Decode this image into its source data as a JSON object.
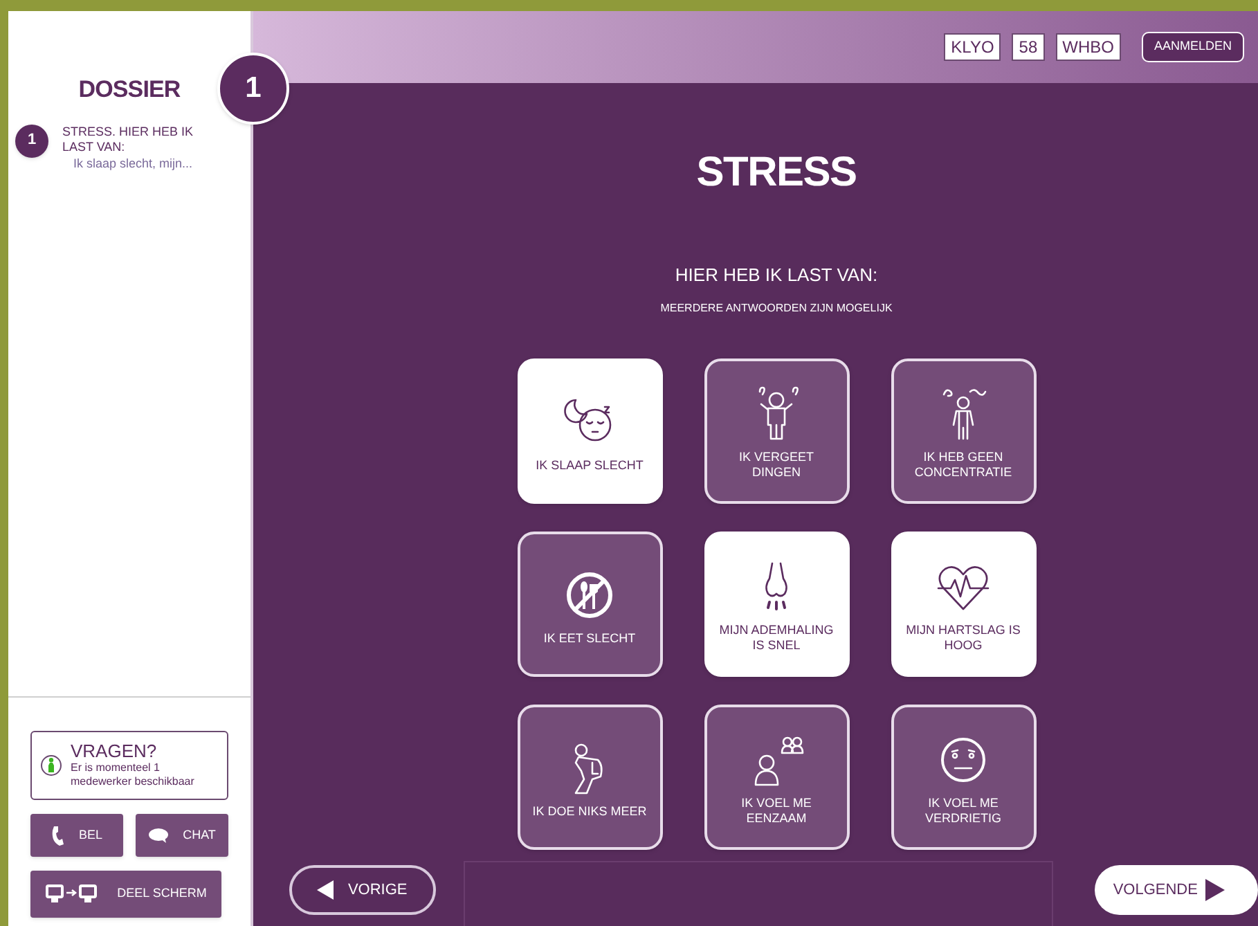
{
  "sidebar": {
    "title": "DOSSIER",
    "items": [
      {
        "number": "1",
        "title": "STRESS. HIER HEB IK LAST VAN:",
        "summary": "Ik slaap slecht, mijn..."
      }
    ],
    "help": {
      "title": "VRAGEN?",
      "status": "Er is momenteel 1 medewerker beschikbaar",
      "online": true
    },
    "buttons": [
      {
        "kind": "call",
        "label": "BEL"
      },
      {
        "kind": "chat",
        "label": "CHAT"
      },
      {
        "kind": "share",
        "label": "DEEL SCHERM"
      }
    ]
  },
  "header": {
    "step": "1",
    "codes": [
      "KLYO",
      "58",
      "WHBO"
    ],
    "login": "AANMELDEN"
  },
  "question": {
    "title": "STRESS",
    "prompt": "HIER HEB IK LAST VAN:",
    "hint": "MEERDERE ANTWOORDEN ZIJN MOGELIJK",
    "options": [
      {
        "label": "IK SLAAP SLECHT",
        "selected": true
      },
      {
        "label": "IK VERGEET DINGEN",
        "selected": false
      },
      {
        "label": "IK HEB GEEN CONCENTRATIE",
        "selected": false
      },
      {
        "label": "IK EET SLECHT",
        "selected": false
      },
      {
        "label": "MIJN ADEMHALING IS SNEL",
        "selected": true
      },
      {
        "label": "MIJN HARTSLAG IS HOOG",
        "selected": true
      },
      {
        "label": "IK DOE NIKS MEER",
        "selected": false
      },
      {
        "label": "IK VOEL ME EENZAAM",
        "selected": false
      },
      {
        "label": "IK VOEL ME VERDRIETIG",
        "selected": false
      }
    ]
  },
  "nav": {
    "back": "VORIGE",
    "next": "VOLGENDE"
  }
}
